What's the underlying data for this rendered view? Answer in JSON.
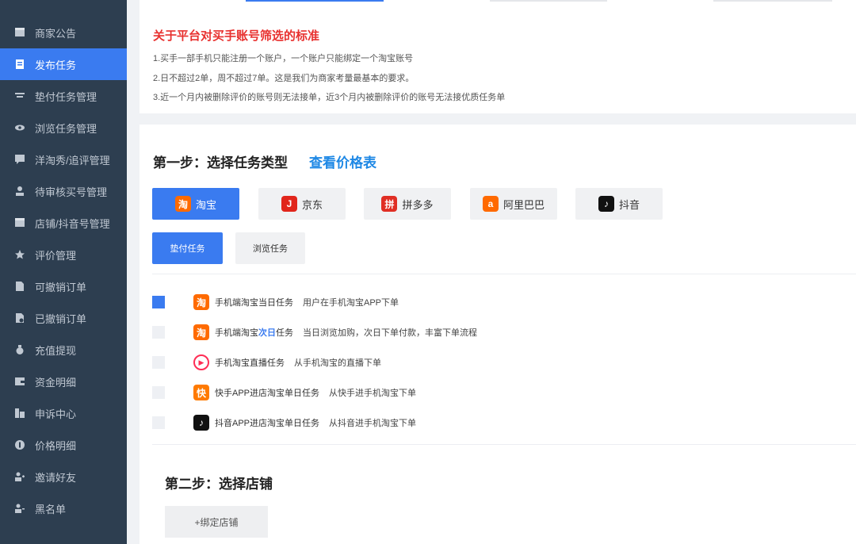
{
  "sidebar": {
    "items": [
      {
        "label": "商家公告",
        "icon": "store-icon"
      },
      {
        "label": "发布任务",
        "icon": "document-icon"
      },
      {
        "label": "垫付任务管理",
        "icon": "list-icon"
      },
      {
        "label": "浏览任务管理",
        "icon": "eye-icon"
      },
      {
        "label": "洋淘秀/追评管理",
        "icon": "comment-icon"
      },
      {
        "label": "待审核买号管理",
        "icon": "user-icon"
      },
      {
        "label": "店铺/抖音号管理",
        "icon": "store-icon"
      },
      {
        "label": "评价管理",
        "icon": "star-icon"
      },
      {
        "label": "可撤销订单",
        "icon": "file-icon"
      },
      {
        "label": "已撤销订单",
        "icon": "file-cancel-icon"
      },
      {
        "label": "充值提现",
        "icon": "money-bag-icon"
      },
      {
        "label": "资金明细",
        "icon": "wallet-icon"
      },
      {
        "label": "申诉中心",
        "icon": "appeal-icon"
      },
      {
        "label": "价格明细",
        "icon": "price-icon"
      },
      {
        "label": "邀请好友",
        "icon": "invite-icon"
      },
      {
        "label": "黑名单",
        "icon": "blacklist-icon"
      }
    ],
    "active_index": 1
  },
  "notice": {
    "title": "关于平台对买手账号筛选的标准",
    "lines": [
      "1.买手一部手机只能注册一个账户，一个账户只能绑定一个淘宝账号",
      "2.日不超过2单，周不超过7单。这是我们为商家考量最基本的要求。",
      "3.近一个月内被删除评价的账号则无法接单，近3个月内被删除评价的账号无法接优质任务单"
    ]
  },
  "step1": {
    "title": "第一步：选择任务类型",
    "price_link": "查看价格表"
  },
  "platforms": [
    {
      "label": "淘宝",
      "icon": "taobao-icon",
      "glyph": "淘",
      "color": "#ff6a00"
    },
    {
      "label": "京东",
      "icon": "jd-icon",
      "glyph": "J",
      "color": "#e1251b"
    },
    {
      "label": "拼多多",
      "icon": "pinduoduo-icon",
      "glyph": "拼",
      "color": "#e02e24"
    },
    {
      "label": "阿里巴巴",
      "icon": "alibaba-icon",
      "glyph": "a",
      "color": "#ff6a00"
    },
    {
      "label": "抖音",
      "icon": "douyin-icon",
      "glyph": "♪",
      "color": "#111111"
    }
  ],
  "task_types": [
    "垫付任务",
    "浏览任务"
  ],
  "tasks": [
    {
      "name": "手机端淘宝当日任务",
      "desc": "用户在手机淘宝APP下单",
      "icon": "taobao-icon",
      "glyph": "淘",
      "color": "#ff6a00",
      "checked": true
    },
    {
      "name_prefix": "手机端淘宝",
      "name_highlight": "次日",
      "name_suffix": "任务",
      "desc": "当日浏览加购，次日下单付款，丰富下单流程",
      "icon": "taobao-icon",
      "glyph": "淘",
      "color": "#ff6a00",
      "checked": false
    },
    {
      "name": "手机淘宝直播任务",
      "desc": "从手机淘宝的直播下单",
      "icon": "taobao-live-icon",
      "glyph": "▶",
      "color": "#ff2d55",
      "checked": false
    },
    {
      "name": "快手APP进店淘宝单日任务",
      "desc": "从快手进手机淘宝下单",
      "icon": "kuaishou-icon",
      "glyph": "快",
      "color": "#ff7a00",
      "checked": false
    },
    {
      "name": "抖音APP进店淘宝单日任务",
      "desc": "从抖音进手机淘宝下单",
      "icon": "douyin-icon",
      "glyph": "♪",
      "color": "#111111",
      "checked": false
    }
  ],
  "step2": {
    "title": "第二步：选择店铺",
    "bind_label": "+绑定店铺"
  },
  "colors": {
    "accent": "#3a7bf0",
    "sidebar_bg": "#2d3e50",
    "notice_title": "#e8312f",
    "link": "#1e88e5"
  }
}
